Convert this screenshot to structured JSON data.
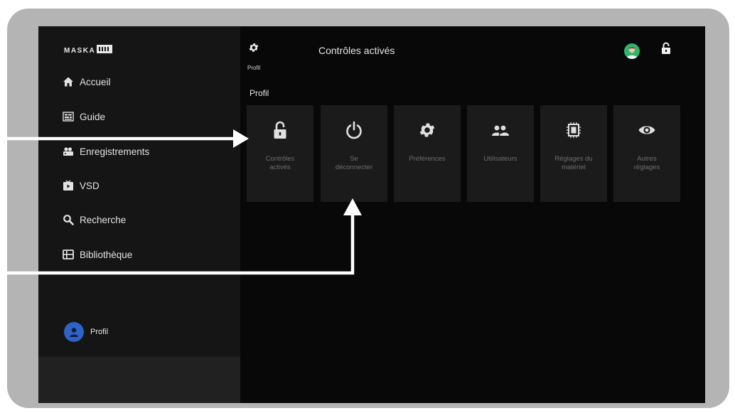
{
  "brand": {
    "logo_text": "MASKA"
  },
  "sidebar": {
    "items": [
      {
        "label": "Accueil",
        "icon": "home-icon"
      },
      {
        "label": "Guide",
        "icon": "guide-icon"
      },
      {
        "label": "Enregistrements",
        "icon": "recordings-icon"
      },
      {
        "label": "VSD",
        "icon": "vsd-icon"
      },
      {
        "label": "Recherche",
        "icon": "search-icon"
      },
      {
        "label": "Bibliothèque",
        "icon": "library-icon"
      }
    ],
    "profile_label": "Profil"
  },
  "header": {
    "gear_label": "Profil",
    "title": "Contrôles activés",
    "section": "Profil"
  },
  "tiles": [
    {
      "label": "Contrôles\nactivés",
      "icon": "lock-icon"
    },
    {
      "label": "Se\ndéconnecter",
      "icon": "power-icon"
    },
    {
      "label": "Préférences",
      "icon": "gear-icon"
    },
    {
      "label": "Utilisateurs",
      "icon": "users-icon"
    },
    {
      "label": "Réglages du\nmatériel",
      "icon": "chip-icon"
    },
    {
      "label": "Autres\nréglages",
      "icon": "eye-icon"
    }
  ],
  "colors": {
    "frame": "#b4b4b4",
    "screen_bg": "#080808",
    "sidebar_bg": "#151515",
    "tile_bg": "#1b1b1b",
    "tile_label": "#6e6e6e",
    "avatar_blue": "#2f62c8",
    "avatar_green": "#2fb46e",
    "annotation_arrow": "#ffffff"
  }
}
